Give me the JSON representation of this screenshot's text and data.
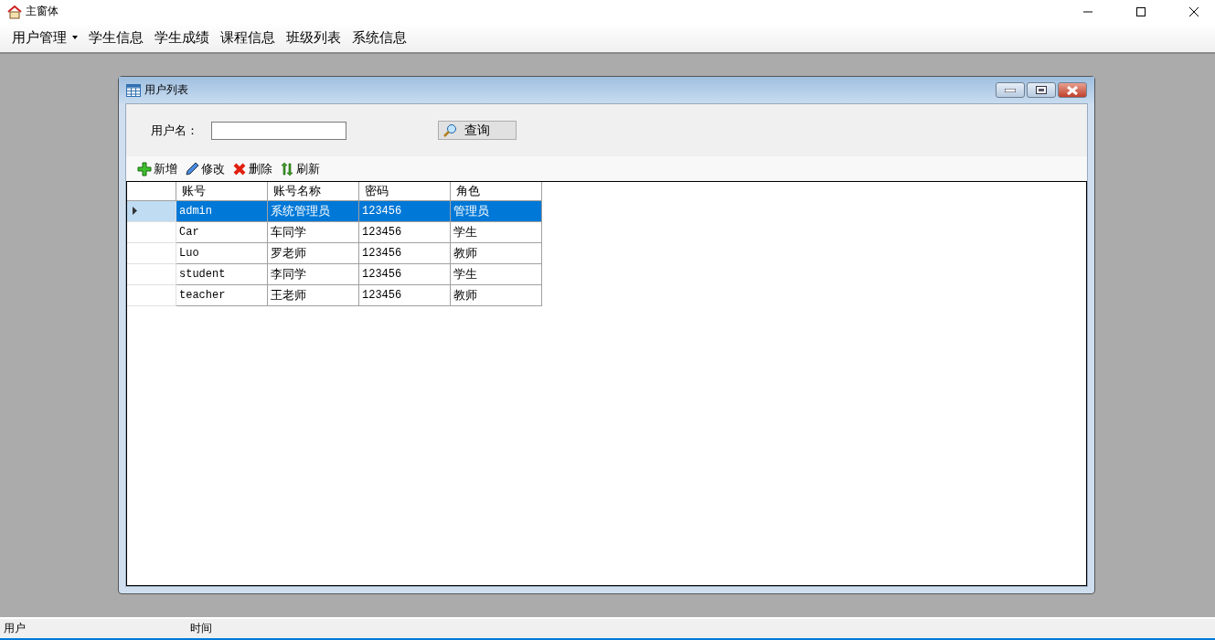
{
  "window": {
    "title": "主窗体"
  },
  "menu": [
    {
      "label": "用户管理",
      "has_dropdown": true
    },
    {
      "label": "学生信息",
      "has_dropdown": false
    },
    {
      "label": "学生成绩",
      "has_dropdown": false
    },
    {
      "label": "课程信息",
      "has_dropdown": false
    },
    {
      "label": "班级列表",
      "has_dropdown": false
    },
    {
      "label": "系统信息",
      "has_dropdown": false
    }
  ],
  "child_window": {
    "title": "用户列表",
    "search": {
      "label": "用户名：",
      "button": "查询"
    },
    "toolbar": [
      {
        "kind": "add",
        "label": "新增"
      },
      {
        "kind": "edit",
        "label": "修改"
      },
      {
        "kind": "delete",
        "label": "删除"
      },
      {
        "kind": "refresh",
        "label": "刷新"
      }
    ],
    "table": {
      "columns": [
        "账号",
        "账号名称",
        "密码",
        "角色"
      ],
      "rows": [
        {
          "cells": [
            "admin",
            "系统管理员",
            "123456",
            "管理员"
          ],
          "selected": true
        },
        {
          "cells": [
            "Car",
            "车同学",
            "123456",
            "学生"
          ],
          "selected": false
        },
        {
          "cells": [
            "Luo",
            "罗老师",
            "123456",
            "教师"
          ],
          "selected": false
        },
        {
          "cells": [
            "student",
            "李同学",
            "123456",
            "学生"
          ],
          "selected": false
        },
        {
          "cells": [
            "teacher",
            "王老师",
            "123456",
            "教师"
          ],
          "selected": false
        }
      ]
    }
  },
  "status_bar": [
    "用户",
    "时间"
  ]
}
